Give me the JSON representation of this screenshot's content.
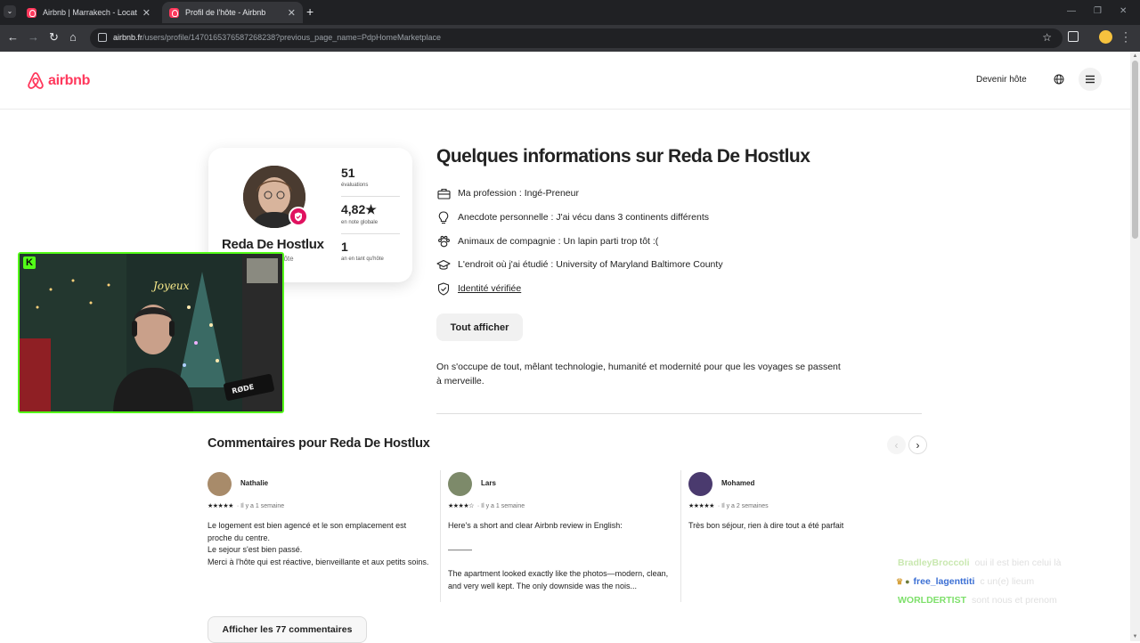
{
  "browser": {
    "tabs": [
      {
        "title": "Airbnb | Marrakech - Locations",
        "active": false
      },
      {
        "title": "Profil de l'hôte - Airbnb",
        "active": true
      }
    ],
    "url_domain": "airbnb.fr",
    "url_path": "/users/profile/1470165376587268238?previous_page_name=PdpHomeMarketplace"
  },
  "header": {
    "logo_text": "airbnb",
    "become_host": "Devenir hôte"
  },
  "profile_card": {
    "name": "Reda De Hostlux",
    "role": "hôte",
    "stats": [
      {
        "value": "51",
        "label": "évaluations"
      },
      {
        "value": "4,82★",
        "label": "en note globale"
      },
      {
        "value": "1",
        "label": "an en tant qu'hôte"
      }
    ]
  },
  "about": {
    "title": "Quelques informations sur Reda De Hostlux",
    "items": [
      {
        "icon": "briefcase-icon",
        "text": "Ma profession : Ingé-Preneur"
      },
      {
        "icon": "lightbulb-icon",
        "text": "Anecdote personnelle : J'ai vécu dans 3 continents différents"
      },
      {
        "icon": "paw-icon",
        "text": "Animaux de compagnie : Un lapin parti trop tôt :("
      },
      {
        "icon": "graduation-cap-icon",
        "text": "L'endroit où j'ai étudié : University of Maryland Baltimore County"
      },
      {
        "icon": "shield-check-icon",
        "text": "Identité vérifiée"
      }
    ],
    "show_all": "Tout afficher",
    "bio": "On s'occupe de tout, mêlant technologie, humanité et modernité pour que les voyages se passent à merveille."
  },
  "reviews": {
    "title": "Commentaires pour Reda De Hostlux",
    "items": [
      {
        "name": "Nathalie",
        "stars": "★★★★★",
        "date": "Il y a 1 semaine",
        "text": "Le logement est bien agencé et le son emplacement est proche du centre.\nLe sejour s'est bien passé.\nMerci à l'hôte qui est réactive, bienveillante et aux petits soins.",
        "avatar_color": "#a88b6a"
      },
      {
        "name": "Lars",
        "stars": "★★★★☆",
        "date": "Il y a 1 semaine",
        "text": "Here's a short and clear Airbnb review in English:\n\n———\n\nThe apartment looked exactly like the photos—modern, clean, and very well kept. The only downside was the nois...",
        "avatar_color": "#7d8a6a"
      },
      {
        "name": "Mohamed",
        "stars": "★★★★★",
        "date": "Il y a 2 semaines",
        "text": "Très bon séjour, rien à dire tout a été parfait",
        "avatar_color": "#4a3a6e"
      }
    ],
    "show_reviews": "Afficher les 77 commentaires"
  },
  "chat": [
    {
      "user": "BradleyBroccoli",
      "message": "oui il est bien celui là",
      "color": "#c9e8b0"
    },
    {
      "user": "free_lagenttiti",
      "message": "c un(e) lieum",
      "color": "#3b6fd4"
    },
    {
      "user": "WORLDERTIST",
      "message": "sont nous et prenom",
      "color": "#7ee06b"
    }
  ],
  "colors": {
    "brand": "#ff385c",
    "kick_green": "#53fc18",
    "verified": "#e0115f"
  }
}
